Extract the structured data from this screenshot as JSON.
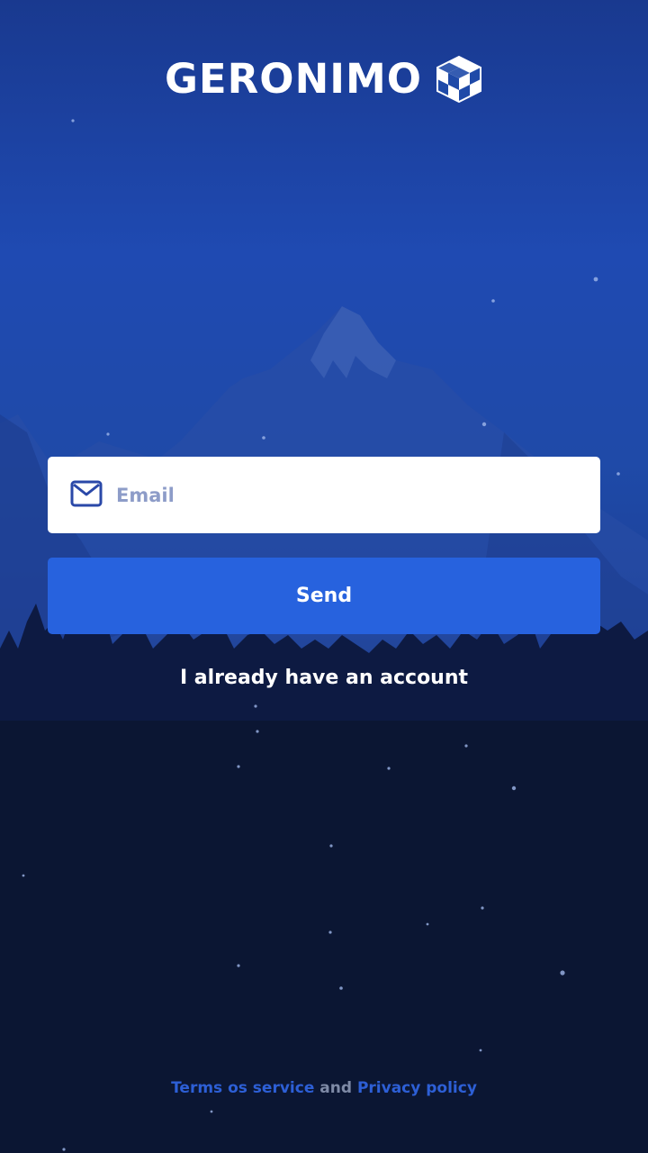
{
  "brand": {
    "name": "GERONIMO"
  },
  "form": {
    "email_placeholder": "Email",
    "email_value": "",
    "send_label": "Send"
  },
  "links": {
    "have_account": "I already have an account"
  },
  "footer": {
    "terms": "Terms os service",
    "and": "and",
    "privacy": "Privacy policy"
  },
  "icons": {
    "logo": "cube-icon",
    "email": "mail-icon"
  },
  "colors": {
    "primary_button": "#2762de",
    "footer_link": "#2d5fd6",
    "sky_top": "#19398f",
    "forest": "#0b1633"
  }
}
